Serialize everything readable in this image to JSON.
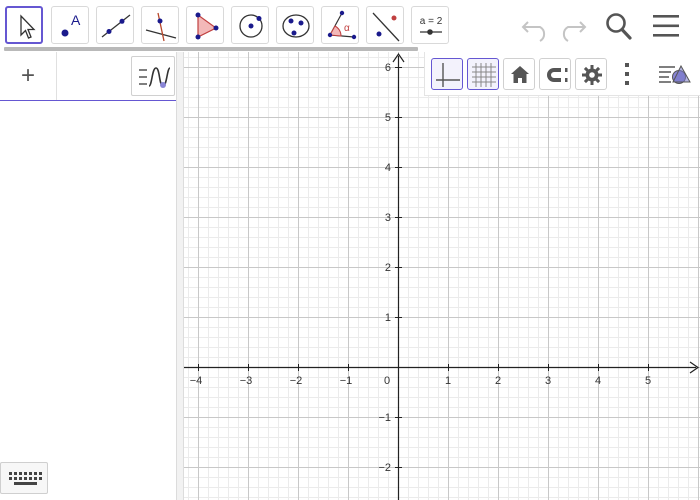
{
  "toolbar": {
    "tools": [
      {
        "name": "move-tool",
        "icon": "arrow-cursor-icon"
      },
      {
        "name": "point-tool",
        "icon": "point-label-icon",
        "label": "A"
      },
      {
        "name": "line-tool",
        "icon": "line-through-points-icon"
      },
      {
        "name": "perpendicular-line-tool",
        "icon": "perpendicular-lines-icon"
      },
      {
        "name": "polygon-tool",
        "icon": "triangle-icon"
      },
      {
        "name": "circle-tool",
        "icon": "circle-center-point-icon"
      },
      {
        "name": "conic-tool",
        "icon": "ellipse-points-icon"
      },
      {
        "name": "angle-tool",
        "icon": "angle-icon",
        "label": "α"
      },
      {
        "name": "reflect-tool",
        "icon": "reflect-about-line-icon"
      },
      {
        "name": "slider-tool",
        "icon": "slider-icon",
        "label": "a = 2"
      }
    ],
    "undo_icon": "undo-icon",
    "redo_icon": "redo-icon",
    "search_icon": "search-icon",
    "menu_icon": "hamburger-menu-icon"
  },
  "algebra": {
    "input_plus": "+",
    "style_icon": "algebra-style-icon",
    "keyboard_icon": "keyboard-icon"
  },
  "graphics": {
    "style_bar": [
      {
        "name": "toggle-axes",
        "icon": "axes-icon",
        "active": true
      },
      {
        "name": "toggle-grid",
        "icon": "grid-icon",
        "active": true
      },
      {
        "name": "standard-view",
        "icon": "home-icon",
        "active": false
      },
      {
        "name": "point-capturing",
        "icon": "magnet-icon",
        "active": false
      },
      {
        "name": "graphics-settings",
        "icon": "gear-icon",
        "active": false
      },
      {
        "name": "more-options",
        "icon": "vertical-dots-icon",
        "active": false
      },
      {
        "name": "show-style-bar",
        "icon": "style-bar-toggle-icon",
        "active": false
      }
    ],
    "x_ticks": [
      "−4",
      "−3",
      "−2",
      "−1",
      "0",
      "1",
      "2",
      "3",
      "4",
      "5"
    ],
    "y_ticks": [
      "6",
      "5",
      "4",
      "3",
      "2",
      "1",
      "−1",
      "−2"
    ],
    "colors": {
      "accent": "#6557d2",
      "point": "#1a1a8c",
      "polygon": "#e05a5a",
      "grid_major": "#c8c8c8",
      "grid_minor": "#ebebeb"
    }
  }
}
